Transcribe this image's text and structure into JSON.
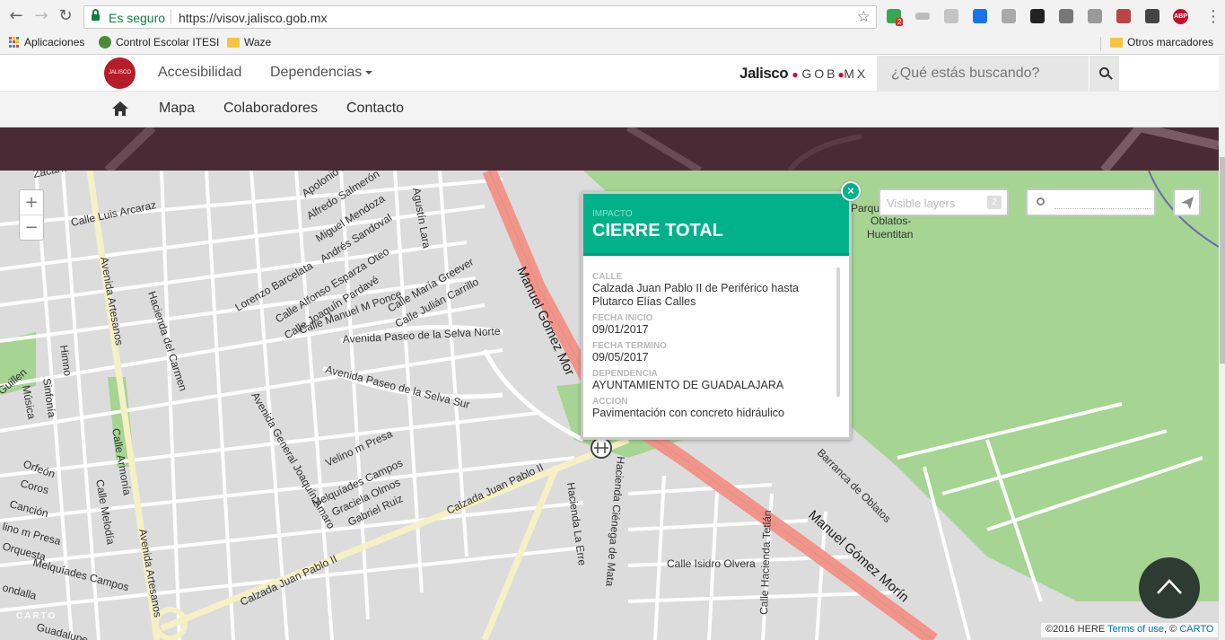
{
  "browser": {
    "security_label": "Es seguro",
    "url": "https://visov.jalisco.gob.mx",
    "ext_badge": "2",
    "abp_label": "ABP",
    "bookmarks": [
      "Aplicaciones",
      "Control Escolar ITESI",
      "Waze"
    ],
    "other_bookmarks": "Otros marcadores"
  },
  "site": {
    "logo_text": "JALISCO",
    "menu": {
      "accessibility": "Accesibilidad",
      "dependencies": "Dependencias"
    },
    "brand": {
      "name": "Jalisco",
      "gob": "GOB",
      "mx": "MX"
    },
    "search_placeholder": "¿Qué estás buscando?",
    "nav": [
      "Mapa",
      "Colaboradores",
      "Contacto"
    ]
  },
  "map": {
    "streets": [
      "Zacarías",
      "Apolonio Mo",
      "Alfredo Salmerón",
      "Miguel Mendoza",
      "Andrés Sandoval",
      "Agustín Lara",
      "Calle Luis Arcaraz",
      "Lorenzo Barcelata",
      "Calle Alfonso Esparza Oteo",
      "Calle Joaquín Pardavé",
      "Calle Manuel M Ponce",
      "Calle María Greever",
      "Calle Julián Carrillo",
      "Avenida Paseo de la Selva Norte",
      "Avenida Paseo de la Selva Sur",
      "Avenida Artesanos",
      "Hacienda del Carmen",
      "Avenida General Joaquín Amaro",
      "Velino m Presa",
      "Melquíades Campos",
      "Graciela Olmos",
      "Gabriel Ruiz",
      "Calzada Juan Pablo II",
      "Hacienda La Erre",
      "Hacienda Ciénega de Mata",
      "Calle Isidro Olvera",
      "Calle Hacienda Tetlán",
      "Barranca de Oblatos",
      "Himno",
      "Sinfonía",
      "Música",
      "Guillen",
      "Calle Armonía",
      "Orfeón",
      "Coros",
      "Calle Melodía",
      "Canción",
      "lino m Presa",
      "Orquesta",
      "ondalla",
      "Guadalupe"
    ],
    "highway": "Manuel Gómez Morín",
    "highway_top": "Manuel Gómez Mor",
    "park": [
      "Parque",
      "Oblatos-",
      "Huentitan"
    ],
    "zoom_in": "+",
    "zoom_out": "−",
    "layers_label": "Visible layers",
    "layers_count": "2",
    "attribution": {
      "here": "©2016 HERE",
      "terms": "Terms of use",
      "sep": ", ©",
      "carto": "CARTO"
    },
    "carto_mark": "CARTO",
    "colors": {
      "park": "#a5d493",
      "highway": "#f0958a",
      "road": "#ffffff",
      "yellow_road": "#f6f0c5",
      "popup_header": "#00b18a"
    }
  },
  "popup": {
    "kicker": "IMPACTO",
    "title": "CIERRE TOTAL",
    "close": "×",
    "fields": [
      {
        "label": "CALLE",
        "value": "Calzada Juan Pablo II de Periférico hasta Plutarco Elías Calles"
      },
      {
        "label": "FECHA INICIO",
        "value": "09/01/2017"
      },
      {
        "label": "FECHA TERMINO",
        "value": "09/05/2017"
      },
      {
        "label": "DEPENDENCIA",
        "value": "AYUNTAMIENTO DE GUADALAJARA"
      },
      {
        "label": "ACCION",
        "value": "Pavimentación con concreto hidráulico"
      }
    ]
  }
}
